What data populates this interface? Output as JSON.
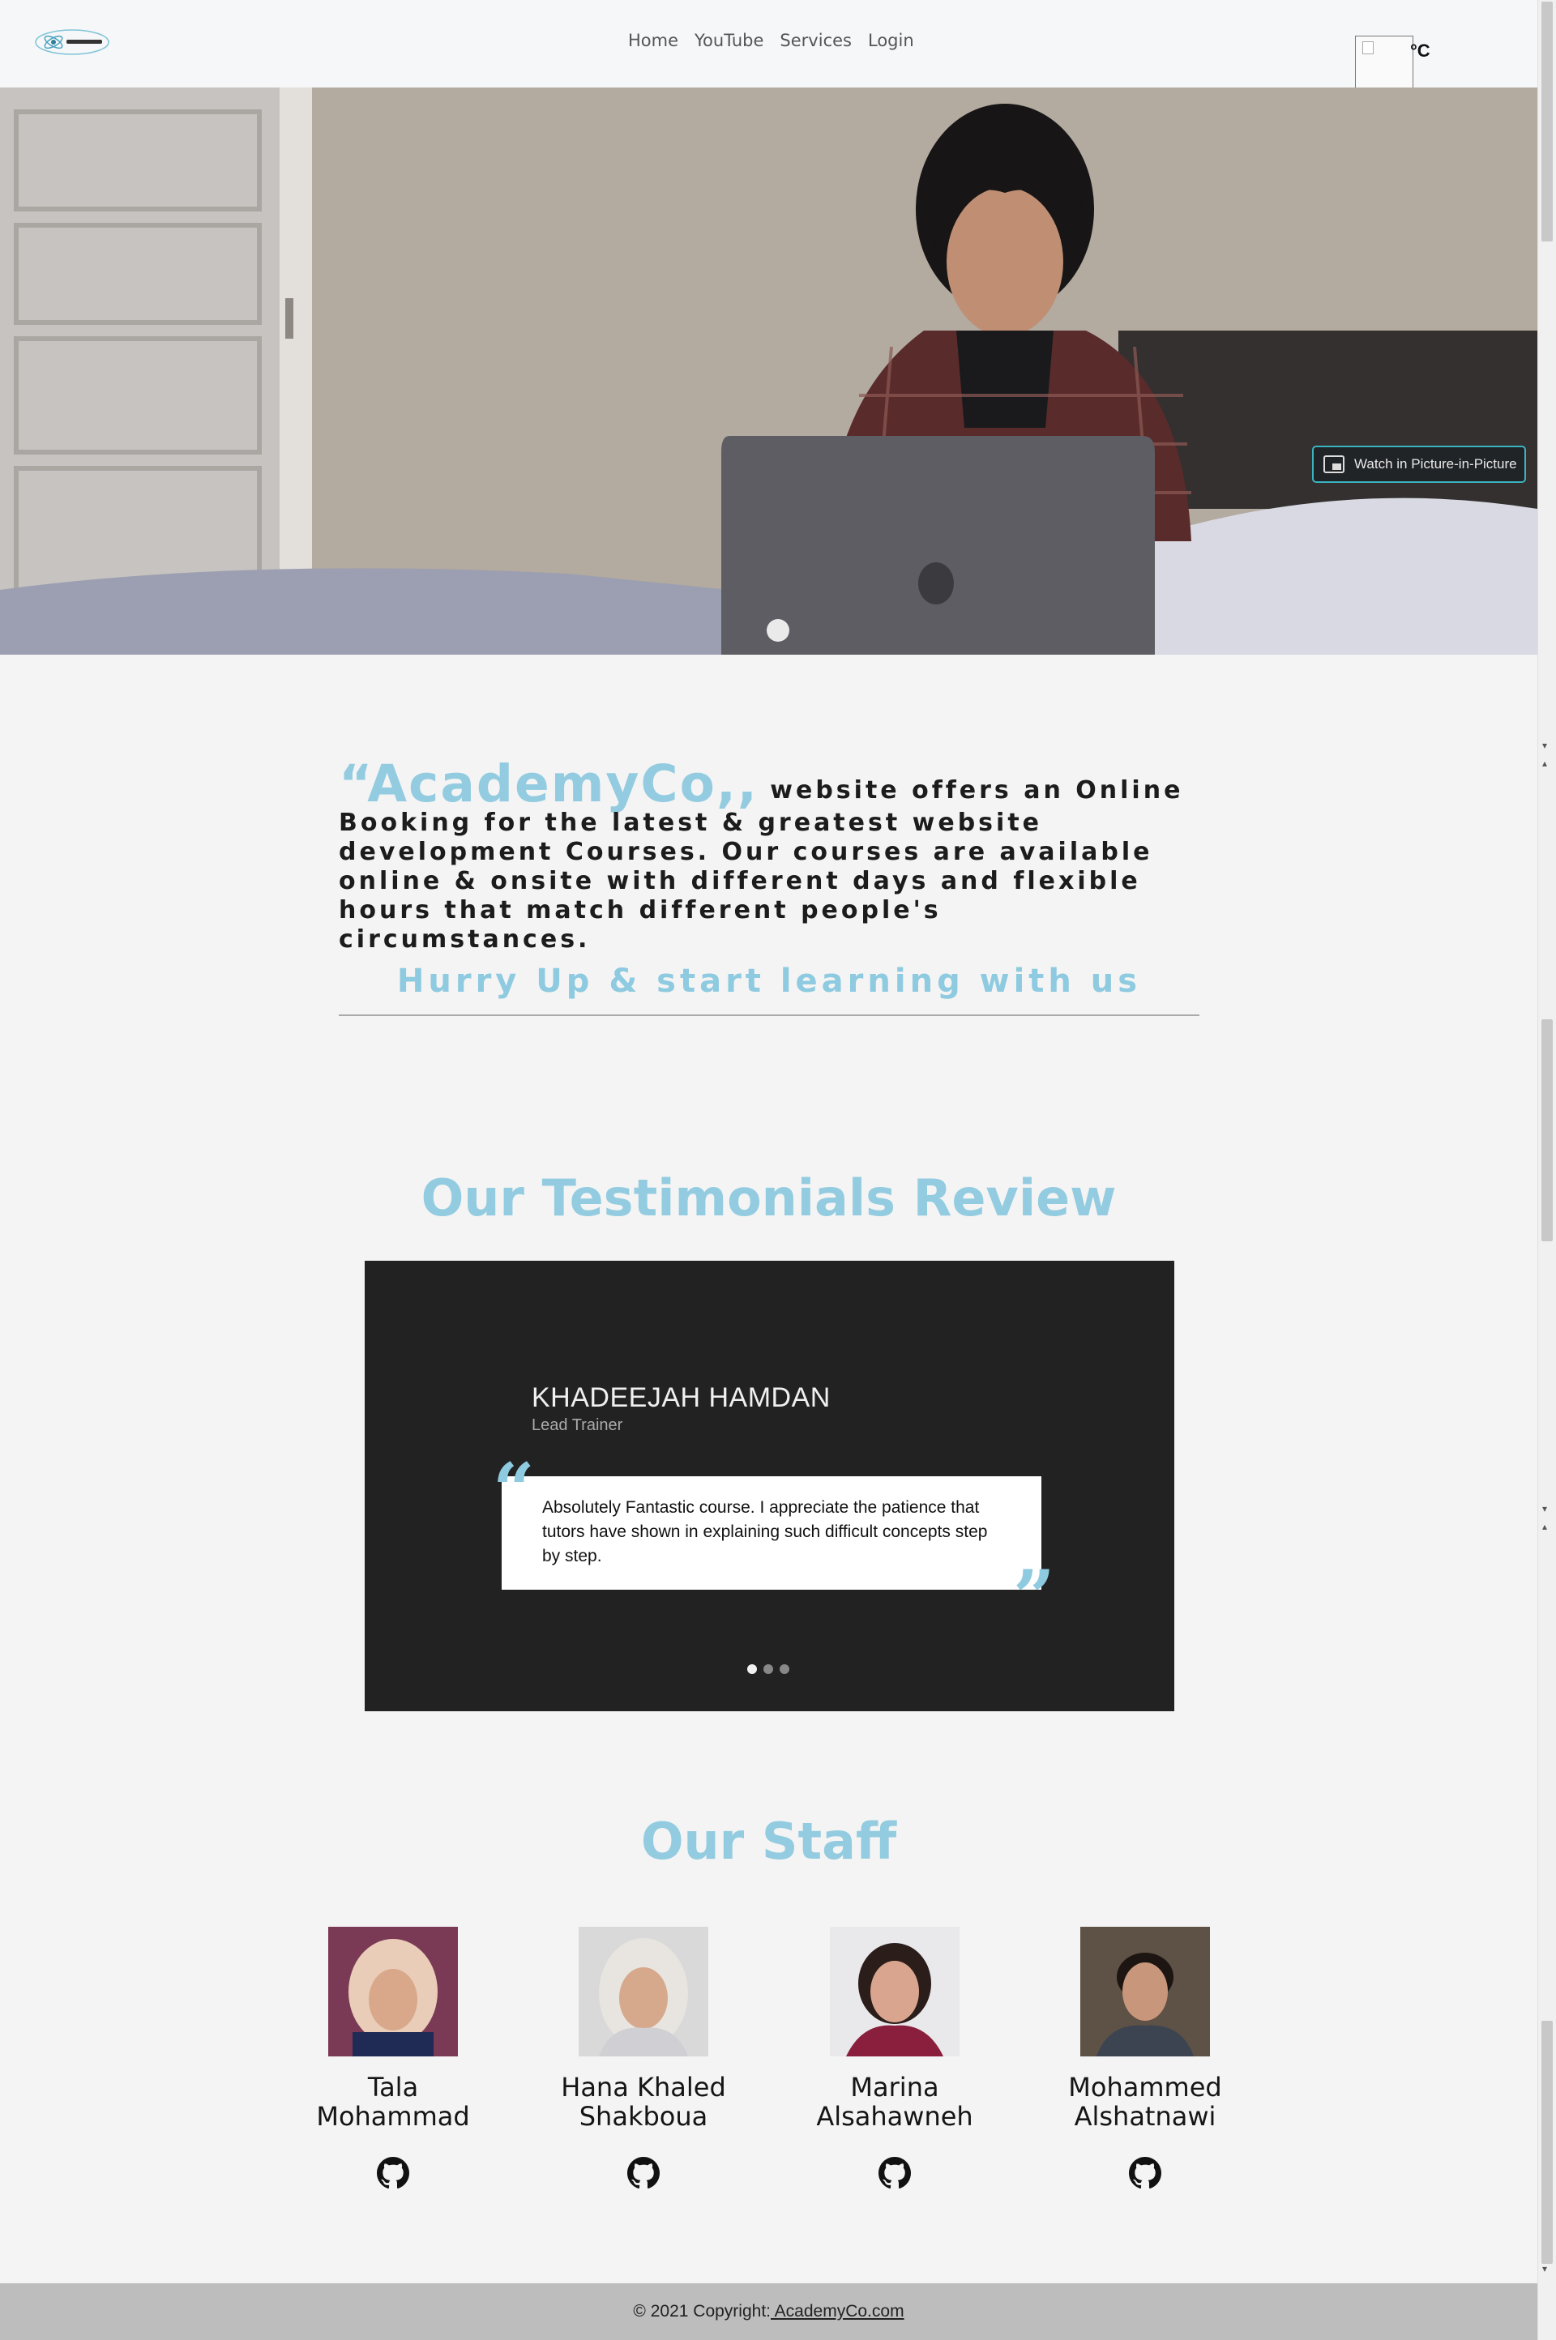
{
  "header": {
    "logo_alt": "AcademyCo",
    "nav": [
      "Home",
      "YouTube",
      "Services",
      "Login"
    ],
    "weather_unit": "°C"
  },
  "hero": {
    "pip_label": "Watch in Picture-in-Picture"
  },
  "about": {
    "brand": "“AcademyCo,,",
    "description": " website offers an Online Booking for the latest & greatest website development Courses. Our courses are available online & onsite with different days and flexible hours that match different people's circumstances.",
    "cta": "Hurry Up & start learning with us"
  },
  "testimonials": {
    "title": "Our Testimonials Review",
    "active": {
      "name": "KHADEEJAH HAMDAN",
      "role": "Lead Trainer",
      "quote": "Absolutely Fantastic course. I appreciate the patience that tutors have shown in explaining such difficult concepts step by step."
    },
    "slide_count": 3,
    "active_index": 0
  },
  "staff": {
    "title": "Our Staff",
    "members": [
      {
        "name": "Tala Mohammad"
      },
      {
        "name": "Hana Khaled Shakboua"
      },
      {
        "name": "Marina Alsahawneh"
      },
      {
        "name": "Mohammed Alshatnawi"
      }
    ]
  },
  "footer": {
    "prefix": "© 2021 Copyright:",
    "link": " AcademyCo.com"
  },
  "colors": {
    "accent": "#93cce0",
    "testimonial_bg": "#222222",
    "footer_bg": "#bdbdbd"
  },
  "icons": {
    "staff_link": "github-icon",
    "quote_open": "quote-open-icon",
    "quote_close": "quote-close-icon"
  }
}
